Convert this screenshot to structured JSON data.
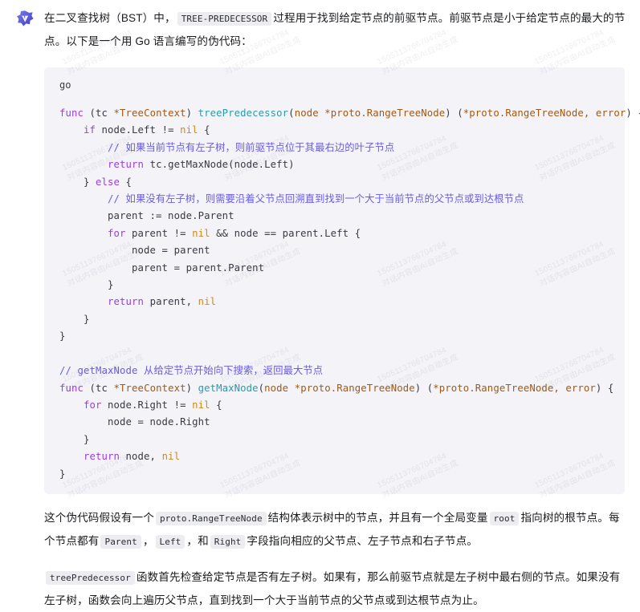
{
  "message": {
    "avatar_icon": "assistant-logo-icon",
    "avatar_color": "#5b5bd6",
    "intro": {
      "part1": "在二叉查找树（BST）中，",
      "code1": "TREE-PREDECESSOR",
      "part2": "过程用于找到给定节点的前驱节点。前驱节点是小于给定节点的最大的节点。以下是一个用 Go 语言编写的伪代码："
    }
  },
  "code_block": {
    "language_label": "go",
    "background": "#f3f3f8",
    "lines": [
      [
        {
          "t": "func ",
          "c": "kw"
        },
        {
          "t": "(tc ",
          "c": "pl"
        },
        {
          "t": "*TreeContext",
          "c": "typ"
        },
        {
          "t": ") ",
          "c": "pl"
        },
        {
          "t": "treePredecessor",
          "c": "fn"
        },
        {
          "t": "(",
          "c": "pl"
        },
        {
          "t": "node *proto.RangeTreeNode",
          "c": "typ"
        },
        {
          "t": ") (",
          "c": "pl"
        },
        {
          "t": "*proto.RangeTreeNode, error",
          "c": "typ"
        },
        {
          "t": ") {",
          "c": "pl"
        }
      ],
      [
        {
          "t": "    ",
          "c": "pl"
        },
        {
          "t": "if ",
          "c": "kw"
        },
        {
          "t": "node.Left != ",
          "c": "pl"
        },
        {
          "t": "nil",
          "c": "nil"
        },
        {
          "t": " {",
          "c": "pl"
        }
      ],
      [
        {
          "t": "        ",
          "c": "pl"
        },
        {
          "t": "// 如果当前节点有左子树，则前驱节点位于其最右边的叶子节点",
          "c": "cmt"
        }
      ],
      [
        {
          "t": "        ",
          "c": "pl"
        },
        {
          "t": "return ",
          "c": "kw"
        },
        {
          "t": "tc.getMaxNode(node.Left)",
          "c": "pl"
        }
      ],
      [
        {
          "t": "    } ",
          "c": "pl"
        },
        {
          "t": "else",
          "c": "kw"
        },
        {
          "t": " {",
          "c": "pl"
        }
      ],
      [
        {
          "t": "        ",
          "c": "pl"
        },
        {
          "t": "// 如果没有左子树，则需要沿着父节点回溯直到找到一个大于当前节点的父节点或到达根节点",
          "c": "cmt"
        }
      ],
      [
        {
          "t": "        parent := node.Parent",
          "c": "pl"
        }
      ],
      [
        {
          "t": "        ",
          "c": "pl"
        },
        {
          "t": "for ",
          "c": "kw"
        },
        {
          "t": "parent != ",
          "c": "pl"
        },
        {
          "t": "nil",
          "c": "nil"
        },
        {
          "t": " && node == parent.Left {",
          "c": "pl"
        }
      ],
      [
        {
          "t": "            node = parent",
          "c": "pl"
        }
      ],
      [
        {
          "t": "            parent = parent.Parent",
          "c": "pl"
        }
      ],
      [
        {
          "t": "        }",
          "c": "pl"
        }
      ],
      [
        {
          "t": "        ",
          "c": "pl"
        },
        {
          "t": "return ",
          "c": "kw"
        },
        {
          "t": "parent, ",
          "c": "pl"
        },
        {
          "t": "nil",
          "c": "nil"
        }
      ],
      [
        {
          "t": "    }",
          "c": "pl"
        }
      ],
      [
        {
          "t": "}",
          "c": "pl"
        }
      ],
      [
        {
          "t": "",
          "c": "pl"
        }
      ],
      [
        {
          "t": "// getMaxNode 从给定节点开始向下搜索，返回最大节点",
          "c": "cmt"
        }
      ],
      [
        {
          "t": "func ",
          "c": "kw"
        },
        {
          "t": "(tc ",
          "c": "pl"
        },
        {
          "t": "*TreeContext",
          "c": "typ"
        },
        {
          "t": ") ",
          "c": "pl"
        },
        {
          "t": "getMaxNode",
          "c": "fn"
        },
        {
          "t": "(",
          "c": "pl"
        },
        {
          "t": "node *proto.RangeTreeNode",
          "c": "typ"
        },
        {
          "t": ") (",
          "c": "pl"
        },
        {
          "t": "*proto.RangeTreeNode, error",
          "c": "typ"
        },
        {
          "t": ") {",
          "c": "pl"
        }
      ],
      [
        {
          "t": "    ",
          "c": "pl"
        },
        {
          "t": "for ",
          "c": "kw"
        },
        {
          "t": "node.Right != ",
          "c": "pl"
        },
        {
          "t": "nil",
          "c": "nil"
        },
        {
          "t": " {",
          "c": "pl"
        }
      ],
      [
        {
          "t": "        node = node.Right",
          "c": "pl"
        }
      ],
      [
        {
          "t": "    }",
          "c": "pl"
        }
      ],
      [
        {
          "t": "    ",
          "c": "pl"
        },
        {
          "t": "return ",
          "c": "kw"
        },
        {
          "t": "node, ",
          "c": "pl"
        },
        {
          "t": "nil",
          "c": "nil"
        }
      ],
      [
        {
          "t": "}",
          "c": "pl"
        }
      ]
    ]
  },
  "explanation": {
    "p1_part1": "这个伪代码假设有一个",
    "p1_code1": "proto.RangeTreeNode",
    "p1_part2": "结构体表示树中的节点，并且有一个全局变量",
    "p1_code2": "root",
    "p1_part3": "指向树的根节点。每个节点都有",
    "p1_code3": "Parent",
    "p1_sep1": "，",
    "p1_code4": "Left",
    "p1_sep2": "，和",
    "p1_code5": "Right",
    "p1_part4": "字段指向相应的父节点、左子节点和右子节点。",
    "p2_code1": "treePredecessor",
    "p2_part1": "函数首先检查给定节点是否有左子树。如果有，那么前驱节点就是左子树中最右侧的节点。如果没有左子树，函数会向上遍历父节点，直到找到一个大于当前节点的父节点或到达根节点为止。"
  },
  "watermark": {
    "id": "1505113766704784",
    "text": "对话内容由AI自动生成"
  }
}
